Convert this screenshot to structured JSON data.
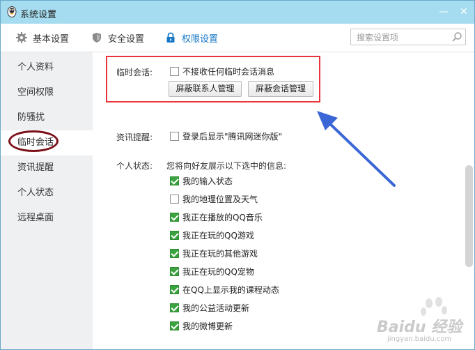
{
  "window": {
    "title": "系统设置",
    "minimize_glyph": "—",
    "close_glyph": "✕"
  },
  "tabs": [
    {
      "label": "基本设置",
      "icon": "gear-icon",
      "active": false
    },
    {
      "label": "安全设置",
      "icon": "shield-icon",
      "active": false
    },
    {
      "label": "权限设置",
      "icon": "lock-icon",
      "active": true
    }
  ],
  "search": {
    "placeholder": "搜索设置项"
  },
  "sidebar": {
    "items": [
      {
        "label": "个人资料",
        "active": false
      },
      {
        "label": "空间权限",
        "active": false
      },
      {
        "label": "防骚扰",
        "active": false
      },
      {
        "label": "临时会话",
        "active": true
      },
      {
        "label": "资讯提醒",
        "active": false
      },
      {
        "label": "个人状态",
        "active": false
      },
      {
        "label": "远程桌面",
        "active": false
      }
    ]
  },
  "temp_session": {
    "label": "临时会话:",
    "reject_option": {
      "label": "不接收任何临时会话消息",
      "checked": false
    },
    "block_contacts_button": "屏蔽联系人管理",
    "block_sessions_button": "屏蔽会话管理"
  },
  "news_reminder": {
    "label": "资讯提醒:",
    "option": {
      "label": "登录后显示\"腾讯网迷你版\"",
      "checked": false
    }
  },
  "personal_status": {
    "label": "个人状态:",
    "description": "您将向好友展示以下选中的信息:",
    "options": [
      {
        "label": "我的输入状态",
        "checked": true
      },
      {
        "label": "我的地理位置及天气",
        "checked": false
      },
      {
        "label": "我正在播放的QQ音乐",
        "checked": true
      },
      {
        "label": "我正在玩的QQ游戏",
        "checked": true
      },
      {
        "label": "我正在玩的其他游戏",
        "checked": true
      },
      {
        "label": "我正在玩的QQ宠物",
        "checked": true
      },
      {
        "label": "在QQ上显示我的课程动态",
        "checked": true
      },
      {
        "label": "我的公益活动更新",
        "checked": true
      },
      {
        "label": "我的微博更新",
        "checked": true
      }
    ]
  },
  "watermark": {
    "brand": "Baidu 经验",
    "url": "jingyan.baidu.com"
  },
  "colors": {
    "titlebar": "#a5dcef",
    "active_tab": "#1778c8",
    "checkbox_checked": "#3aa23f",
    "highlight_box": "#e8343a",
    "arrow": "#3b66d6",
    "circle": "#7b1219"
  }
}
